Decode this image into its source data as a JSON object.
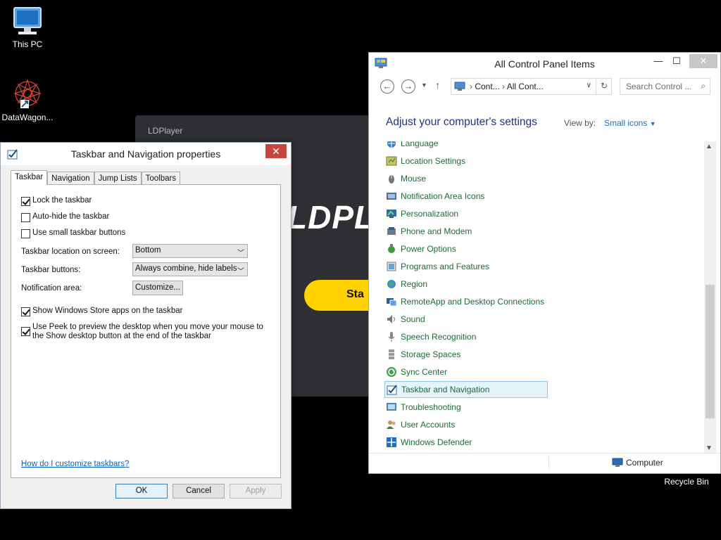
{
  "desktop": {
    "this_pc": "This PC",
    "datawagon": "DataWagon...",
    "recycle_bin": "Recycle Bin"
  },
  "ldplayer": {
    "title": "LDPlayer",
    "logo_text": "LDPLA",
    "start_text": "Sta"
  },
  "dialog": {
    "title": "Taskbar and Navigation properties",
    "close_label": "✕",
    "tabs": [
      "Taskbar",
      "Navigation",
      "Jump Lists",
      "Toolbars"
    ],
    "active_tab": "Taskbar",
    "checkboxes": {
      "lock": {
        "label": "Lock the taskbar",
        "checked": true
      },
      "autohide": {
        "label": "Auto-hide the taskbar",
        "checked": false
      },
      "small": {
        "label": "Use small taskbar buttons",
        "checked": false
      },
      "store": {
        "label": "Show Windows Store apps on the taskbar",
        "checked": true
      },
      "peek": {
        "label": "Use Peek to preview the desktop when you move your mouse to the Show desktop button at the end of the taskbar",
        "checked": true
      }
    },
    "location_label": "Taskbar location on screen:",
    "location_value": "Bottom",
    "buttons_label": "Taskbar buttons:",
    "buttons_value": "Always combine, hide labels",
    "notification_label": "Notification area:",
    "customize_label": "Customize...",
    "help_link": "How do I customize taskbars?",
    "ok": "OK",
    "cancel": "Cancel",
    "apply": "Apply"
  },
  "control_panel": {
    "title": "All Control Panel Items",
    "min": "—",
    "max": "☐",
    "close": "✕",
    "breadcrumb_1": "Cont...",
    "breadcrumb_2": "All Cont...",
    "search_placeholder": "Search Control ...",
    "heading": "Adjust your computer's settings",
    "view_by_label": "View by:",
    "view_by_value": "Small icons",
    "items": [
      "Language",
      "Location Settings",
      "Mouse",
      "Notification Area Icons",
      "Personalization",
      "Phone and Modem",
      "Power Options",
      "Programs and Features",
      "Region",
      "RemoteApp and Desktop Connections",
      "Sound",
      "Speech Recognition",
      "Storage Spaces",
      "Sync Center",
      "Taskbar and Navigation",
      "Troubleshooting",
      "User Accounts",
      "Windows Defender"
    ],
    "selected_item": "Taskbar and Navigation",
    "status_computer": "Computer"
  },
  "colors": {
    "link_green": "#1e6b38",
    "heading_blue": "#1e3287",
    "close_red": "#c7463d",
    "ld_yellow": "#ffd200"
  }
}
